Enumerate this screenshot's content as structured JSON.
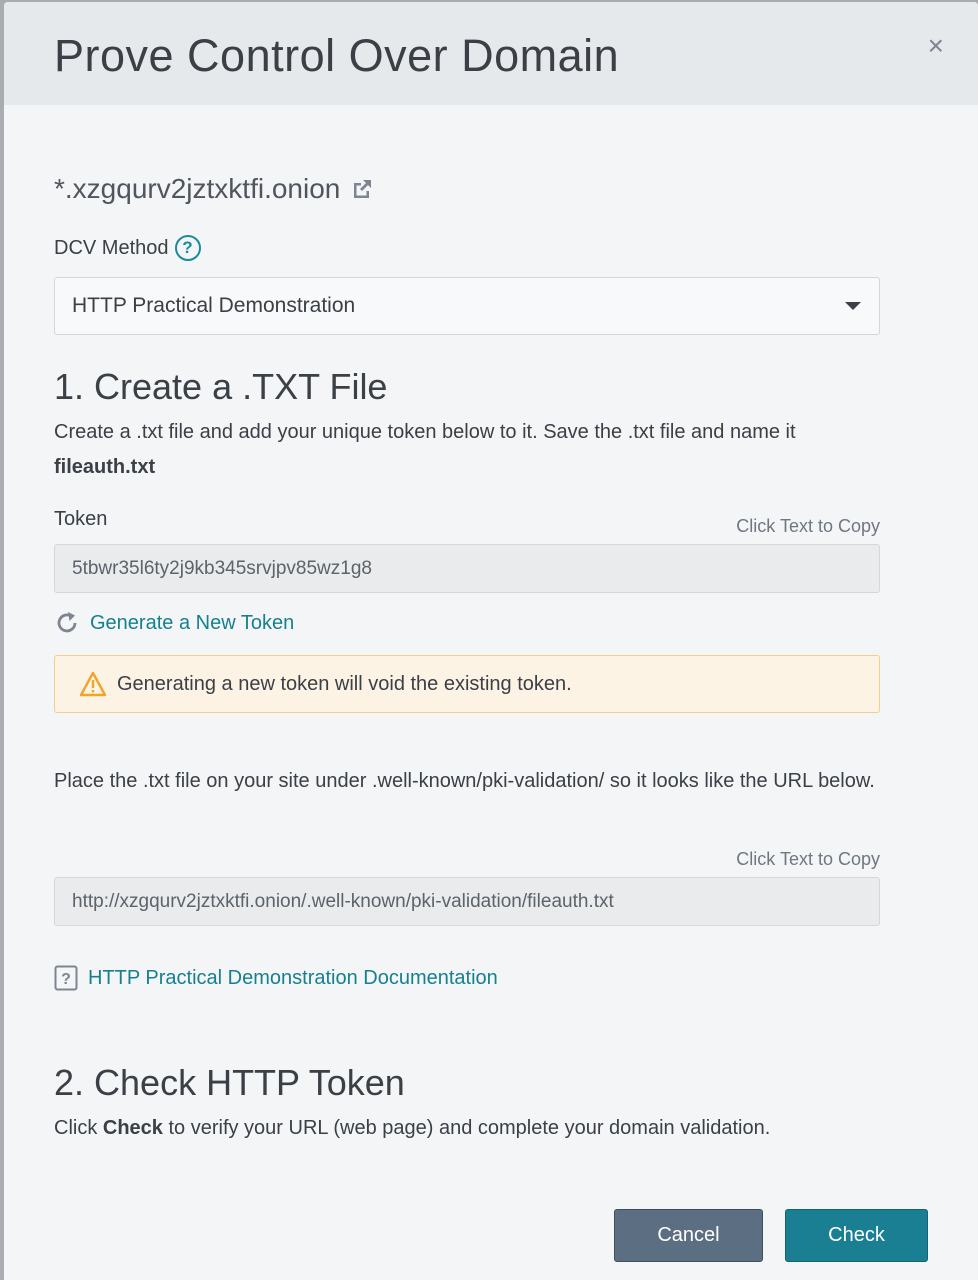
{
  "modal": {
    "title": "Prove Control Over Domain",
    "close_symbol": "×"
  },
  "domain": {
    "name": "*.xzgqurv2jztxktfi.onion",
    "icon": "external-link-icon"
  },
  "dcv": {
    "label": "DCV Method",
    "help_icon": "question-circle-icon",
    "help_symbol": "?",
    "selected": "HTTP Practical Demonstration"
  },
  "step1": {
    "title": "1. Create a .TXT File",
    "instruction_prefix": "Create a .txt file and add your unique token below to it. Save the .txt file and name it",
    "filename": "fileauth.txt",
    "token_label": "Token",
    "copy_hint": "Click Text to Copy",
    "token_value": "5tbwr35l6ty2j9kb345srvjpv85wz1g8",
    "generate_label": "Generate a New Token",
    "warning_text": "Generating a new token will void the existing token.",
    "place_instruction": "Place the .txt file on your site under .well-known/pki-validation/ so it looks like the URL below.",
    "url_copy_hint": "Click Text to Copy",
    "url_value": "http://xzgqurv2jztxktfi.onion/.well-known/pki-validation/fileauth.txt",
    "doc_link": "HTTP Practical Demonstration Documentation"
  },
  "step2": {
    "title": "2. Check HTTP Token",
    "prefix": "Click ",
    "bold": "Check",
    "suffix": " to verify your URL (web page) and complete your domain validation."
  },
  "buttons": {
    "cancel": "Cancel",
    "check": "Check"
  },
  "colors": {
    "accent": "#1a7f92",
    "link": "#17808f",
    "warning_bg": "#fdf3e4",
    "warning_border": "#f1cf8d",
    "cancel_bg": "#5b6e82"
  }
}
